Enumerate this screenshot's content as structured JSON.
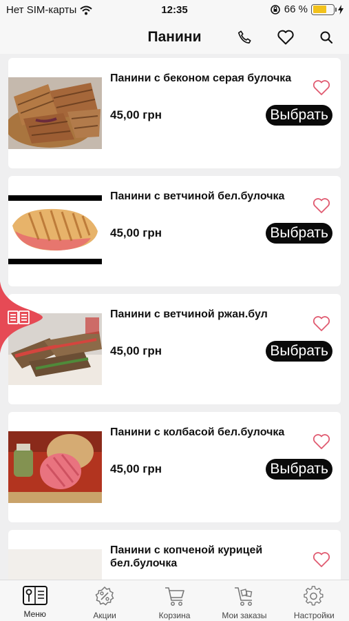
{
  "status": {
    "carrier": "Нет SIM-карты",
    "time": "12:35",
    "battery_text": "66 %",
    "battery_level": 0.66,
    "battery_color": "#f2c21b"
  },
  "header": {
    "title": "Панини",
    "icons": [
      "phone-icon",
      "heart-icon",
      "search-icon"
    ]
  },
  "products": [
    {
      "name": "Панини с беконом серая булочка",
      "price": "45,00 грн",
      "button": "Выбрать",
      "image": "panini-bacon-photo"
    },
    {
      "name": "Панини с ветчиной бел.булочка",
      "price": "45,00 грн",
      "button": "Выбрать",
      "image": "panini-ham-white-photo"
    },
    {
      "name": "Панини с ветчиной ржан.бул",
      "price": "45,00 грн",
      "button": "Выбрать",
      "image": "panini-ham-rye-photo"
    },
    {
      "name": "Панини с колбасой бел.булочка",
      "price": "45,00 грн",
      "button": "Выбрать",
      "image": "panini-sausage-photo"
    },
    {
      "name": "Панини с копченой курицей бел.булочка",
      "price": "",
      "button": "",
      "image": "panini-chicken-photo"
    }
  ],
  "tabs": [
    {
      "label": "Меню",
      "icon": "menu-book-icon",
      "active": true
    },
    {
      "label": "Акции",
      "icon": "discount-icon",
      "active": false
    },
    {
      "label": "Корзина",
      "icon": "cart-icon",
      "active": false
    },
    {
      "label": "Мои заказы",
      "icon": "orders-cart-icon",
      "active": false
    },
    {
      "label": "Настройки",
      "icon": "gear-icon",
      "active": false
    }
  ],
  "colors": {
    "accent": "#e64a55",
    "button": "#0a0a0a",
    "heart": "#e05a70"
  }
}
